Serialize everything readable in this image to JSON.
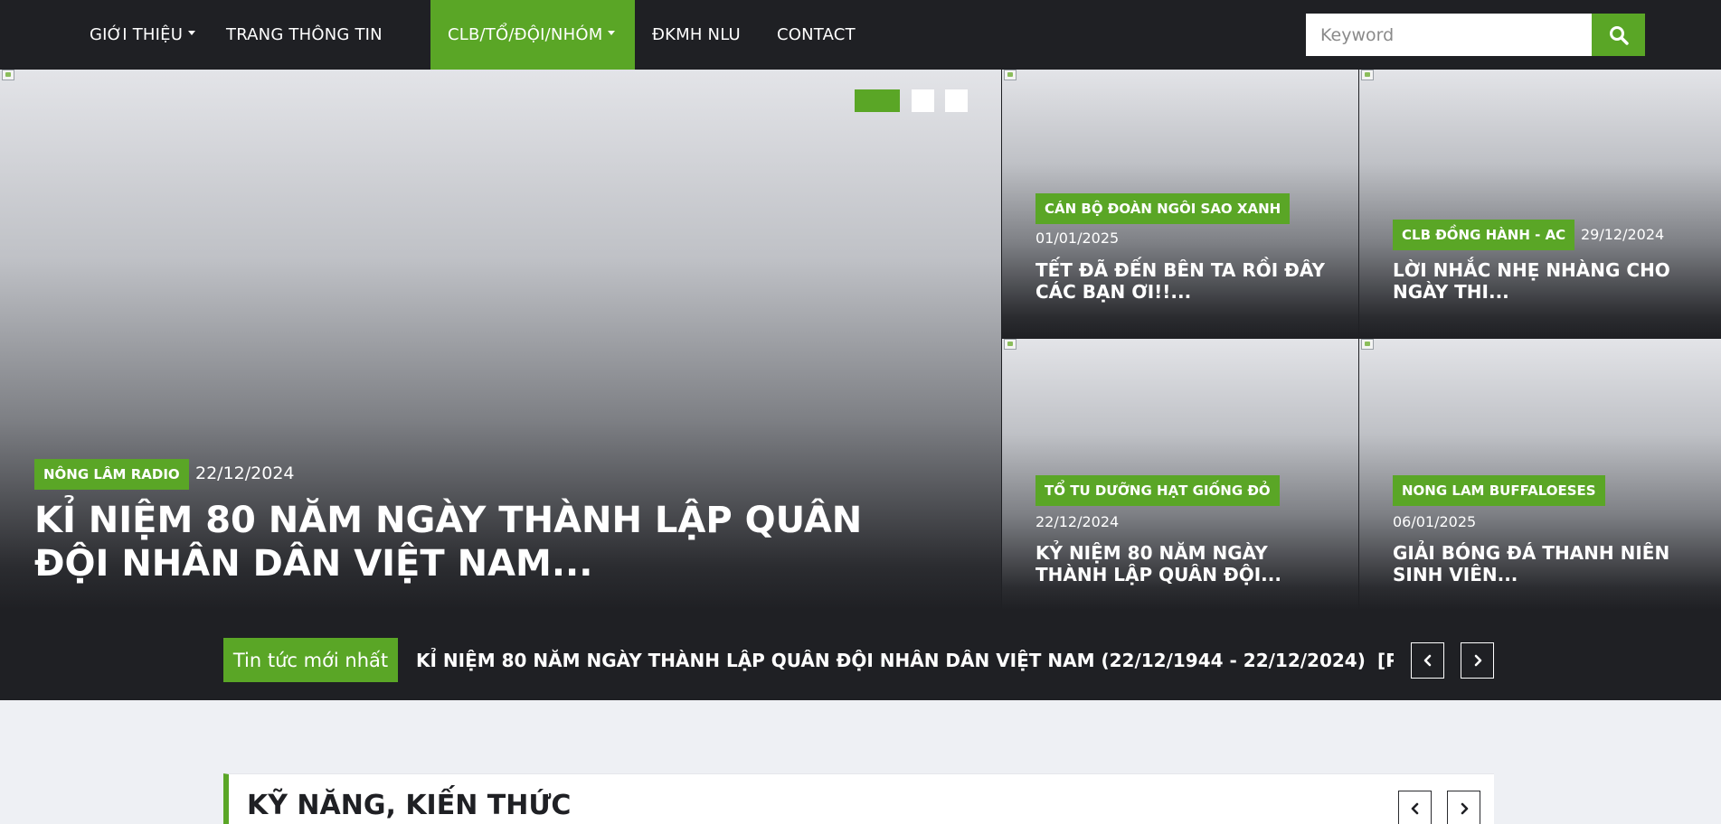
{
  "nav": {
    "items": [
      {
        "label": "GIỚI THIỆU",
        "has_dropdown": true
      },
      {
        "label": "TRANG THÔNG TIN",
        "has_dropdown": false
      },
      {
        "label": "CLB/TỔ/ĐỘI/NHÓM",
        "has_dropdown": true,
        "active": true
      },
      {
        "label": "ĐKMH NLU",
        "has_dropdown": false
      },
      {
        "label": "CONTACT",
        "has_dropdown": false
      }
    ],
    "search_placeholder": "Keyword",
    "search_icon": "search-icon"
  },
  "hero": {
    "main": {
      "category": "NÔNG LÂM RADIO",
      "date": "22/12/2024",
      "title": "KỈ NIỆM 80 NĂM NGÀY THÀNH LẬP QUÂN ĐỘI NHÂN DÂN VIỆT NAM..."
    },
    "side": [
      {
        "category": "CÁN BỘ ĐOÀN NGÔI SAO XANH",
        "date": "01/01/2025",
        "title": "TẾT ĐÃ ĐẾN BÊN TA RỒI ĐÂY CÁC BẠN ƠI!!..."
      },
      {
        "category": "CLB ĐỒNG HÀNH - AC",
        "date": "29/12/2024",
        "title": "LỜI NHẮC NHẸ NHÀNG CHO NGÀY THI..."
      },
      {
        "category": "TỔ TU DƯỠNG HẠT GIỐNG ĐỎ",
        "date": "22/12/2024",
        "title": "KỶ NIỆM 80 NĂM NGÀY THÀNH LẬP QUÂN ĐỘI..."
      },
      {
        "category": "NONG LAM BUFFALOESES",
        "date": "06/01/2025",
        "title": "GIẢI BÓNG ĐÁ THANH NIÊN SINH VIÊN..."
      }
    ],
    "slider": {
      "count": 3,
      "active_index": 0
    }
  },
  "ticker": {
    "label": "Tin tức mới nhất",
    "headline": "KỈ NIỆM 80 NĂM NGÀY THÀNH LẬP QUÂN ĐỘI NHÂN DÂN VIỆT NAM (22/12/1944 - 22/12/2024)",
    "next_headline_fragment": "[P"
  },
  "section": {
    "title": "KỸ NĂNG, KIẾN THỨC"
  },
  "colors": {
    "accent": "#5aa626",
    "dark": "#1f2024",
    "page_bg": "#eef0f4"
  }
}
